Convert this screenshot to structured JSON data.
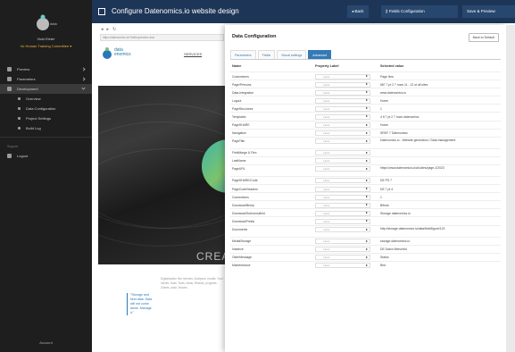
{
  "sidebar": {
    "user_name": "Vicki Eleter",
    "site_name": "Vo Human Training Committee ▾",
    "items": [
      {
        "label": "Preview"
      },
      {
        "label": "Parameters"
      },
      {
        "label": "Development"
      }
    ],
    "subitems": [
      {
        "label": "Overview"
      },
      {
        "label": "Data Configuration"
      },
      {
        "label": "Project Settings"
      },
      {
        "label": "Build Log"
      }
    ],
    "section_label": "Support",
    "bottom_item": "Logout",
    "footer": "Account"
  },
  "topbar": {
    "title": "Configure Datenomics.io website design",
    "back_label": "◂ Back",
    "configure_label": "⟫ Fields Configuration",
    "save_label": "Save & Preview"
  },
  "preview": {
    "url": "https://datenomics.io/?editorpreview=true",
    "logo_text": "data enomics",
    "nav_link": "SERVICES",
    "hero_heading": "CREA",
    "quote": "\"Storage and field data. Data will not come alone. Manage it.\"",
    "body_text": "Digitalization five minutes. Analyses, results. Your clients. Data. Tools, ideas. Results, progress. Clients, data. Visions."
  },
  "modal": {
    "title": "Data Configuration",
    "default_button": "Back to Default",
    "tabs": [
      "Parameters",
      "Fields",
      "Visual settings",
      "Advanced"
    ],
    "active_tab": 3,
    "columns": {
      "name": "Name",
      "prop": "Property Label",
      "value": "Selected value"
    },
    "rows": [
      {
        "name": "Customizers",
        "prop": "Label",
        "value": "Page flow"
      },
      {
        "name": "Page/Persons",
        "prop": "Label",
        "value": "687 7 pt 2 7 rows 11 - 12 of all sites"
      },
      {
        "name": "Data-integration",
        "prop": "Label",
        "value": "www.datenomics.io"
      },
      {
        "name": "Logout",
        "prop": "Label",
        "value": "Home"
      },
      {
        "name": "PageStructures",
        "prop": "Label",
        "value": "1"
      },
      {
        "name": "Templates",
        "prop": "Label",
        "value": "4 ft 7 pt 2 7 rows datenomics"
      },
      {
        "name": "PageSHARE",
        "prop": "Label",
        "value": "Home"
      },
      {
        "name": "Navigation",
        "prop": "Label",
        "value": "SREF 7 Datenomics"
      },
      {
        "name": "PageTitle",
        "prop": "Label",
        "value": "Datenomics.io - Website generation / Data management",
        "tall": true
      },
      {
        "name": "FieldMarge & Flex",
        "prop": "Label",
        "value": ""
      },
      {
        "name": "LastName",
        "prop": "Label",
        "value": ""
      },
      {
        "name": "PageURL",
        "prop": "Label",
        "value": "https://www.datenomics.io/all-sites/page-1/2023",
        "tall": true
      },
      {
        "name": "PageSHARE/Code",
        "prop": "Label",
        "value": "DE PS 7"
      },
      {
        "name": "PageCodeHeaders",
        "prop": "Label",
        "value": "DE 7 pt 4"
      },
      {
        "name": "Connections",
        "prop": "Label",
        "value": "1"
      },
      {
        "name": "Download/Bkrep",
        "prop": "Label",
        "value": "Bifrost"
      },
      {
        "name": "Download/Submenufield",
        "prop": "Label",
        "value": "Storage datenomics.io"
      },
      {
        "name": "Download/Fields",
        "prop": "Label",
        "value": ""
      },
      {
        "name": "Documents",
        "prop": "Label",
        "value": "http://storage.datenomics.io/data/field/figure/123",
        "tall": true
      },
      {
        "name": "MediaStorage",
        "prop": "Label",
        "value": "storage.datenomics.io"
      },
      {
        "name": "Instance",
        "prop": "Label",
        "value": "DE Datun Menuhtld"
      },
      {
        "name": "OlderMessage",
        "prop": "Label",
        "value": "Status"
      },
      {
        "name": "Mainentrance",
        "prop": "Label",
        "value": "Bird"
      }
    ]
  }
}
